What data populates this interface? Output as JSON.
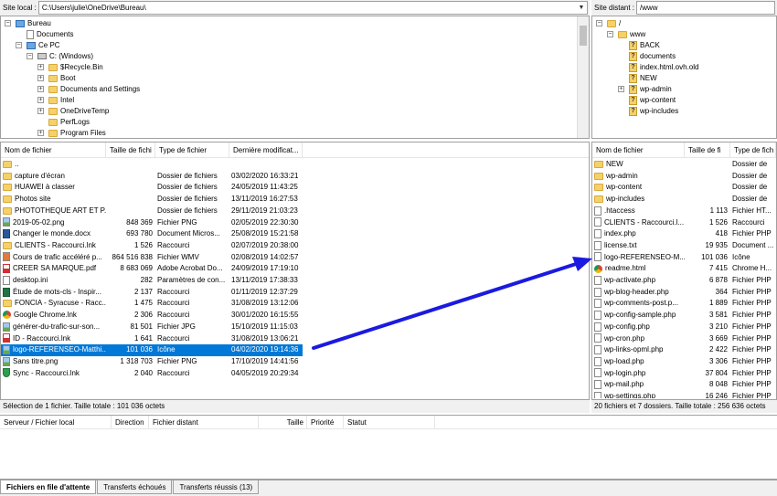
{
  "local": {
    "site_label": "Site local :",
    "path": "C:\\Users\\julie\\OneDrive\\Bureau\\",
    "tree": [
      {
        "label": "Bureau",
        "icon": "computer-icon",
        "level": 0,
        "expander": "-"
      },
      {
        "label": "Documents",
        "icon": "document-icon",
        "level": 1,
        "expander": ""
      },
      {
        "label": "Ce PC",
        "icon": "computer-icon",
        "level": 1,
        "expander": "-"
      },
      {
        "label": "C: (Windows)",
        "icon": "drive-icon",
        "level": 2,
        "expander": "-"
      },
      {
        "label": "$Recycle.Bin",
        "icon": "folder-icon",
        "level": 3,
        "expander": "+"
      },
      {
        "label": "Boot",
        "icon": "folder-icon",
        "level": 3,
        "expander": "+"
      },
      {
        "label": "Documents and Settings",
        "icon": "folder-icon",
        "level": 3,
        "expander": "+"
      },
      {
        "label": "Intel",
        "icon": "folder-icon",
        "level": 3,
        "expander": "+"
      },
      {
        "label": "OneDriveTemp",
        "icon": "folder-icon",
        "level": 3,
        "expander": "+"
      },
      {
        "label": "PerfLogs",
        "icon": "folder-icon",
        "level": 3,
        "expander": ""
      },
      {
        "label": "Program Files",
        "icon": "folder-icon",
        "level": 3,
        "expander": "+"
      }
    ],
    "columns": [
      "Nom de fichier",
      "Taille de fichi",
      "Type de fichier",
      "Dernière modificat..."
    ],
    "files": [
      {
        "name": "..",
        "size": "",
        "type": "",
        "date": "",
        "icon": "folder-icon"
      },
      {
        "name": "capture d'écran",
        "size": "",
        "type": "Dossier de fichiers",
        "date": "03/02/2020 16:33:21",
        "icon": "folder-icon"
      },
      {
        "name": "HUAWEI à classer",
        "size": "",
        "type": "Dossier de fichiers",
        "date": "24/05/2019 11:43:25",
        "icon": "folder-icon"
      },
      {
        "name": "Photos site",
        "size": "",
        "type": "Dossier de fichiers",
        "date": "13/11/2019 16:27:53",
        "icon": "folder-icon"
      },
      {
        "name": "PHOTOTHEQUE ART ET P...",
        "size": "",
        "type": "Dossier de fichiers",
        "date": "29/11/2019 21:03:23",
        "icon": "folder-icon"
      },
      {
        "name": "2019-05-02.png",
        "size": "848 369",
        "type": "Fichier PNG",
        "date": "02/05/2019 22:30:30",
        "icon": "image-icon"
      },
      {
        "name": "Changer le monde.docx",
        "size": "693 780",
        "type": "Document Micros...",
        "date": "25/08/2019 15:21:58",
        "icon": "word-icon"
      },
      {
        "name": "CLIENTS - Raccourci.lnk",
        "size": "1 526",
        "type": "Raccourci",
        "date": "02/07/2019 20:38:00",
        "icon": "folder-icon"
      },
      {
        "name": "Cours de trafic accéléré p...",
        "size": "864 516 838",
        "type": "Fichier WMV",
        "date": "02/08/2019 14:02:57",
        "icon": "video-icon"
      },
      {
        "name": "CREER SA MARQUE.pdf",
        "size": "8 683 069",
        "type": "Adobe Acrobat Do...",
        "date": "24/09/2019 17:19:10",
        "icon": "pdf-icon"
      },
      {
        "name": "desktop.ini",
        "size": "282",
        "type": "Paramètres de con...",
        "date": "13/11/2019 17:38:33",
        "icon": "document-icon"
      },
      {
        "name": "Étude de mots-cls - Inspir...",
        "size": "2 137",
        "type": "Raccourci",
        "date": "01/11/2019 12:37:29",
        "icon": "excel-icon"
      },
      {
        "name": "FONCIA - Syracuse - Racc...",
        "size": "1 475",
        "type": "Raccourci",
        "date": "31/08/2019 13:12:06",
        "icon": "folder-icon"
      },
      {
        "name": "Google Chrome.lnk",
        "size": "2 306",
        "type": "Raccourci",
        "date": "30/01/2020 16:15:55",
        "icon": "chrome-icon"
      },
      {
        "name": "générer-du-trafic-sur-son...",
        "size": "81 501",
        "type": "Fichier JPG",
        "date": "15/10/2019 11:15:03",
        "icon": "image-icon"
      },
      {
        "name": "ID - Raccourci.lnk",
        "size": "1 641",
        "type": "Raccourci",
        "date": "31/08/2019 13:06:21",
        "icon": "pdf-icon"
      },
      {
        "name": "logo-REFERENSEO-Matthi...",
        "size": "101 036",
        "type": "Icône",
        "date": "04/02/2020 19:14:36",
        "icon": "image-icon",
        "selected": true
      },
      {
        "name": "Sans titre.png",
        "size": "1 318 703",
        "type": "Fichier PNG",
        "date": "17/10/2019 14:41:56",
        "icon": "image-icon"
      },
      {
        "name": "Sync - Raccourci.lnk",
        "size": "2 040",
        "type": "Raccourci",
        "date": "04/05/2019 20:29:34",
        "icon": "shield-icon"
      }
    ],
    "status": "Sélection de 1 fichier. Taille totale : 101 036 octets"
  },
  "remote": {
    "site_label": "Site distant :",
    "path": "/www",
    "tree": [
      {
        "label": "/",
        "icon": "folder-icon",
        "level": 0,
        "expander": "-"
      },
      {
        "label": "www",
        "icon": "folder-icon",
        "level": 1,
        "expander": "-"
      },
      {
        "label": "BACK",
        "icon": "unknown-folder-icon",
        "level": 2,
        "expander": ""
      },
      {
        "label": "documents",
        "icon": "unknown-folder-icon",
        "level": 2,
        "expander": ""
      },
      {
        "label": "index.html.ovh.old",
        "icon": "unknown-folder-icon",
        "level": 2,
        "expander": ""
      },
      {
        "label": "NEW",
        "icon": "unknown-folder-icon",
        "level": 2,
        "expander": ""
      },
      {
        "label": "wp-admin",
        "icon": "unknown-folder-icon",
        "level": 2,
        "expander": "+"
      },
      {
        "label": "wp-content",
        "icon": "unknown-folder-icon",
        "level": 2,
        "expander": ""
      },
      {
        "label": "wp-includes",
        "icon": "unknown-folder-icon",
        "level": 2,
        "expander": ""
      }
    ],
    "columns": [
      "Nom de fichier",
      "Taille de fi",
      "Type de fich"
    ],
    "files": [
      {
        "name": "NEW",
        "size": "",
        "type": "Dossier de",
        "icon": "folder-icon"
      },
      {
        "name": "wp-admin",
        "size": "",
        "type": "Dossier de",
        "icon": "folder-icon"
      },
      {
        "name": "wp-content",
        "size": "",
        "type": "Dossier de",
        "icon": "folder-icon"
      },
      {
        "name": "wp-includes",
        "size": "",
        "type": "Dossier de",
        "icon": "folder-icon"
      },
      {
        "name": ".htaccess",
        "size": "1 113",
        "type": "Fichier HT...",
        "icon": "document-icon"
      },
      {
        "name": "CLIENTS - Raccourci.l...",
        "size": "1 526",
        "type": "Raccourci",
        "icon": "document-icon"
      },
      {
        "name": "index.php",
        "size": "418",
        "type": "Fichier PHP",
        "icon": "document-icon"
      },
      {
        "name": "license.txt",
        "size": "19 935",
        "type": "Document ...",
        "icon": "document-icon"
      },
      {
        "name": "logo-REFERENSEO-M...",
        "size": "101 036",
        "type": "Icône",
        "icon": "document-icon"
      },
      {
        "name": "readme.html",
        "size": "7 415",
        "type": "Chrome H...",
        "icon": "chrome-icon"
      },
      {
        "name": "wp-activate.php",
        "size": "6 878",
        "type": "Fichier PHP",
        "icon": "document-icon"
      },
      {
        "name": "wp-blog-header.php",
        "size": "364",
        "type": "Fichier PHP",
        "icon": "document-icon"
      },
      {
        "name": "wp-comments-post.p...",
        "size": "1 889",
        "type": "Fichier PHP",
        "icon": "document-icon"
      },
      {
        "name": "wp-config-sample.php",
        "size": "3 581",
        "type": "Fichier PHP",
        "icon": "document-icon"
      },
      {
        "name": "wp-config.php",
        "size": "3 210",
        "type": "Fichier PHP",
        "icon": "document-icon"
      },
      {
        "name": "wp-cron.php",
        "size": "3 669",
        "type": "Fichier PHP",
        "icon": "document-icon"
      },
      {
        "name": "wp-links-opml.php",
        "size": "2 422",
        "type": "Fichier PHP",
        "icon": "document-icon"
      },
      {
        "name": "wp-load.php",
        "size": "3 306",
        "type": "Fichier PHP",
        "icon": "document-icon"
      },
      {
        "name": "wp-login.php",
        "size": "37 804",
        "type": "Fichier PHP",
        "icon": "document-icon"
      },
      {
        "name": "wp-mail.php",
        "size": "8 048",
        "type": "Fichier PHP",
        "icon": "document-icon"
      },
      {
        "name": "wp-settings.php",
        "size": "16 246",
        "type": "Fichier PHP",
        "icon": "document-icon"
      }
    ],
    "status": "20 fichiers et 7 dossiers. Taille totale : 256 636 octets"
  },
  "queue": {
    "columns": [
      "Serveur / Fichier local",
      "Direction",
      "Fichier distant",
      "Taille",
      "Priorité",
      "Statut"
    ]
  },
  "tabs": [
    {
      "label": "Fichiers en file d'attente",
      "active": true
    },
    {
      "label": "Transferts échoués",
      "active": false
    },
    {
      "label": "Transferts réussis (13)",
      "active": false
    }
  ],
  "colors": {
    "selection": "#0078d7",
    "arrow": "#1a1ae0",
    "folder": "#f4d16a"
  }
}
